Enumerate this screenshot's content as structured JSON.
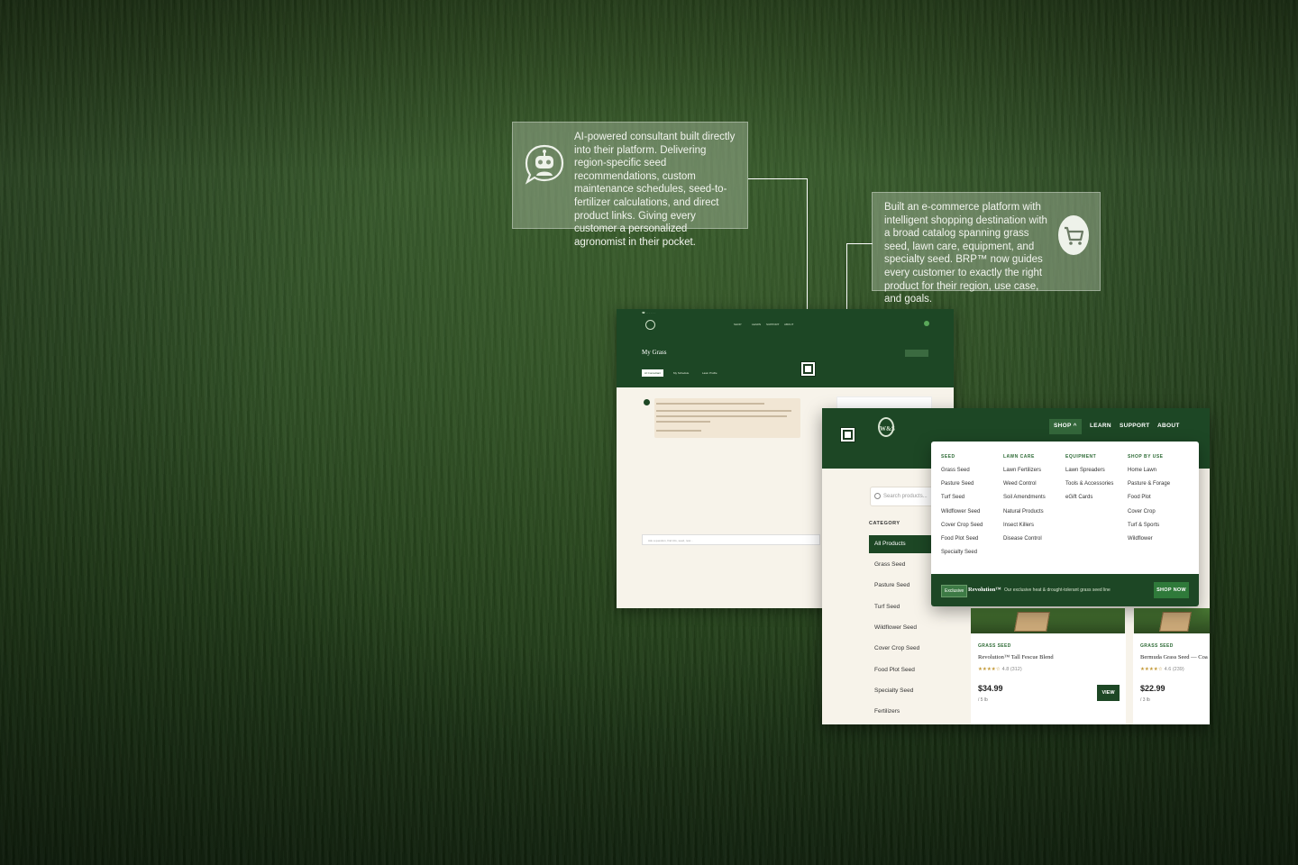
{
  "callouts": {
    "chatbot": {
      "text": "AI-powered consultant built directly into their platform. Delivering region-specific seed recommendations, custom maintenance schedules, seed-to-fertilizer calculations, and direct product links. Giving every customer a personalized agronomist in their pocket.",
      "icon": "robot-chat-icon"
    },
    "ecommerce": {
      "text": "Built an e-commerce platform with intelligent shopping destination with a broad catalog spanning grass seed, lawn care, equipment, and specialty seed. BRP™ now guides every customer to exactly the right product for their region, use case, and goals.",
      "icon": "cart-icon"
    }
  },
  "my_grass": {
    "title": "My Grass",
    "tabs": [
      "AI Consultant",
      "My Schedule",
      "Lawn Profile"
    ],
    "nav": [
      "SHOP",
      "LEARN",
      "SUPPORT",
      "ABOUT"
    ],
    "input_placeholder": "Ask a question, find info, seed, now..."
  },
  "shop": {
    "logo_text": "W&S",
    "nav": [
      "SHOP",
      "LEARN",
      "SUPPORT",
      "ABOUT"
    ],
    "shop_caret": "^",
    "search_placeholder": "Search products...",
    "category_heading": "CATEGORY",
    "categories": [
      "All Products",
      "Grass Seed",
      "Pasture Seed",
      "Turf Seed",
      "Wildflower Seed",
      "Cover Crop Seed",
      "Food Plot Seed",
      "Specialty Seed",
      "Fertilizers"
    ],
    "active_category": "All Products",
    "products": [
      {
        "category": "GRASS SEED",
        "title": "Revolution™ Tall Fescue Blend",
        "stars": "★★★★☆",
        "rating": "4.8 (312)",
        "price": "$34.99",
        "unit": "/ 5 lb",
        "button": "VIEW"
      },
      {
        "category": "GRASS SEED",
        "title": "Bermuda Grass Seed — Coa",
        "stars": "★★★★☆",
        "rating": "4.6 (239)",
        "price": "$22.99",
        "unit": "/ 3 lb"
      }
    ]
  },
  "mega_menu": {
    "columns": [
      {
        "heading": "SEED",
        "items": [
          "Grass Seed",
          "Pasture Seed",
          "Turf Seed",
          "Wildflower Seed",
          "Cover Crop Seed",
          "Food Plot Seed",
          "Specialty Seed"
        ]
      },
      {
        "heading": "LAWN CARE",
        "items": [
          "Lawn Fertilizers",
          "Weed Control",
          "Soil Amendments",
          "Natural Products",
          "Insect Killers",
          "Disease Control"
        ]
      },
      {
        "heading": "EQUIPMENT",
        "items": [
          "Lawn Spreaders",
          "Tools & Accessories",
          "eGift Cards"
        ]
      },
      {
        "heading": "SHOP BY USE",
        "items": [
          "Home Lawn",
          "Pasture & Forage",
          "Food Plot",
          "Cover Crop",
          "Turf & Sports",
          "Wildflower"
        ]
      }
    ],
    "banner": {
      "badge": "Exclusive",
      "brand": "Revolution™",
      "description": "Our exclusive heat & drought-tolerant grass seed line",
      "button": "SHOP NOW"
    }
  },
  "colors": {
    "brand_green": "#1d4725",
    "accent_green": "#2e6b36",
    "cream": "#f7f3ea"
  }
}
